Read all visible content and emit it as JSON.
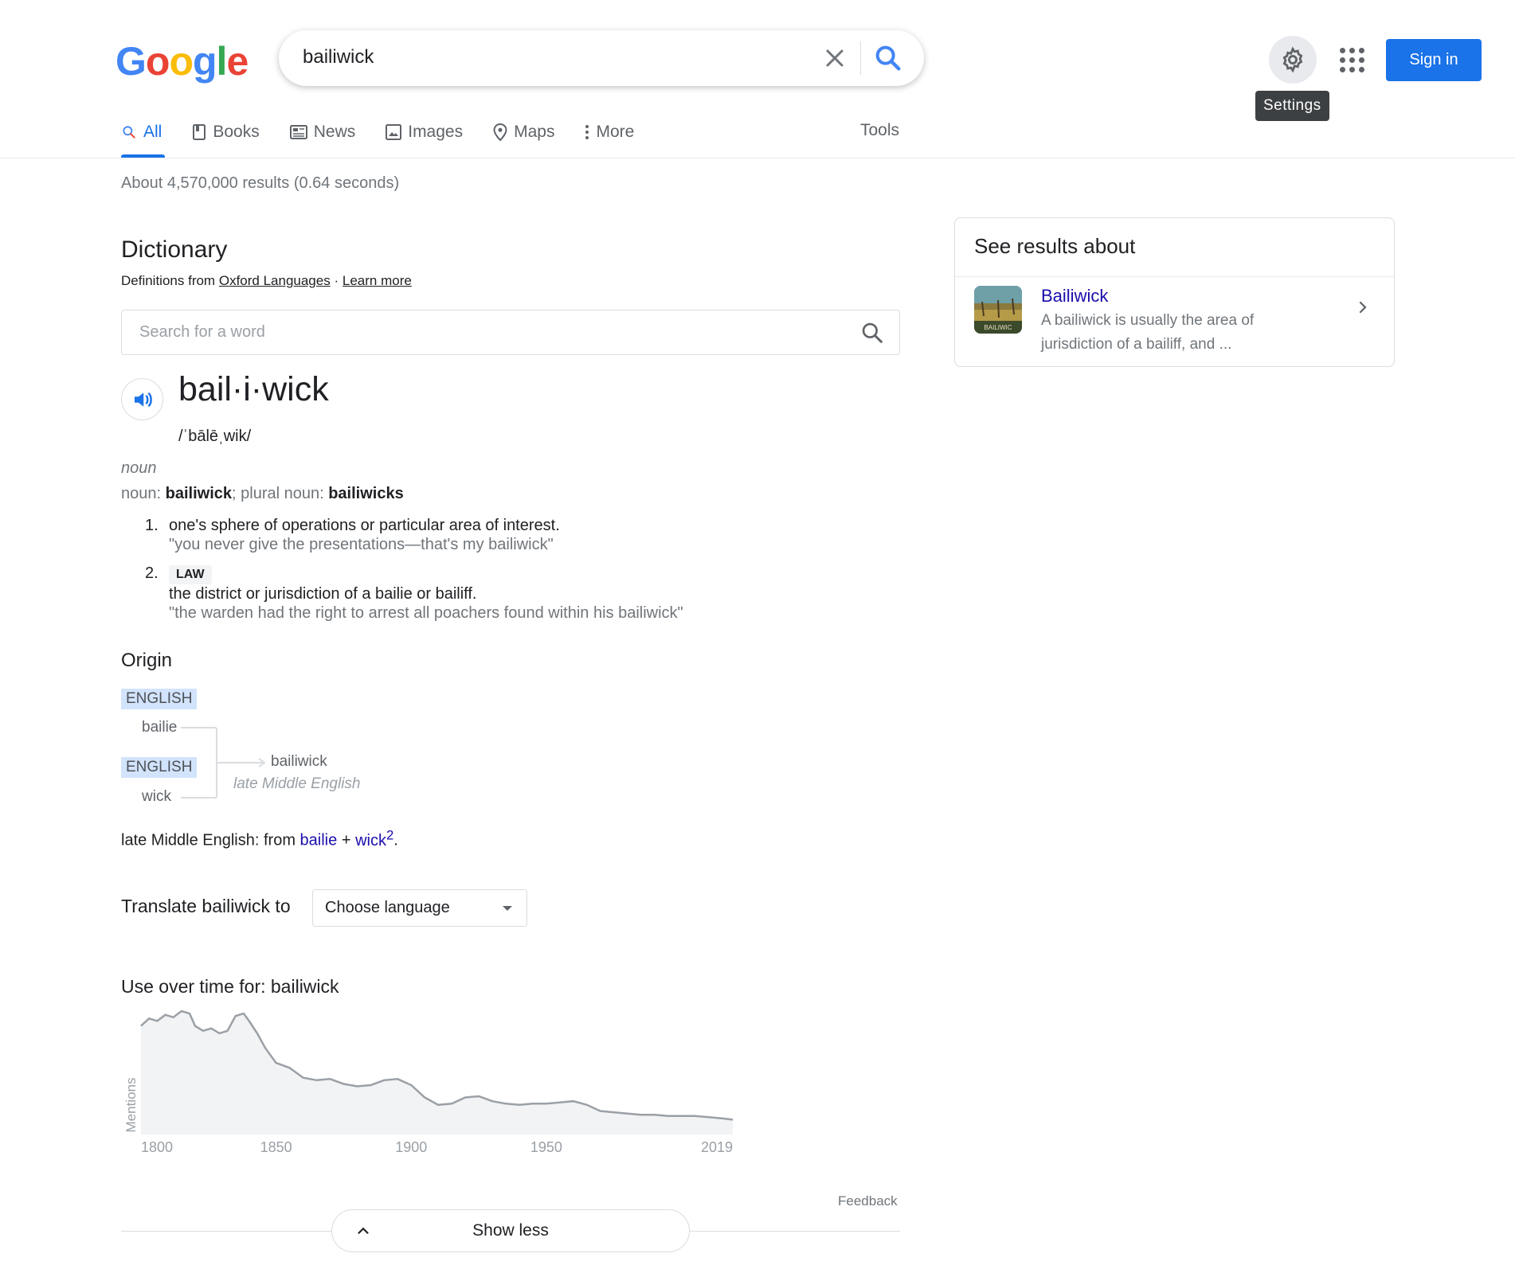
{
  "header": {
    "logo_letters": [
      {
        "ch": "G",
        "color": "#4285F4"
      },
      {
        "ch": "o",
        "color": "#EA4335"
      },
      {
        "ch": "o",
        "color": "#FBBC05"
      },
      {
        "ch": "g",
        "color": "#4285F4"
      },
      {
        "ch": "l",
        "color": "#34A853"
      },
      {
        "ch": "e",
        "color": "#EA4335"
      }
    ],
    "search_query": "bailiwick",
    "settings_tooltip": "Settings",
    "signin_label": "Sign in"
  },
  "tabs": [
    {
      "label": "All",
      "icon": "search-icon",
      "active": true
    },
    {
      "label": "Books",
      "icon": "book-icon"
    },
    {
      "label": "News",
      "icon": "news-icon"
    },
    {
      "label": "Images",
      "icon": "image-icon"
    },
    {
      "label": "Maps",
      "icon": "map-pin-icon"
    },
    {
      "label": "More",
      "icon": "more-vert-icon"
    }
  ],
  "tools_label": "Tools",
  "result_stats": "About 4,570,000 results (0.64 seconds)",
  "dictionary": {
    "title": "Dictionary",
    "source_prefix": "Definitions from",
    "source_link": "Oxford Languages",
    "source_sep": "·",
    "learn_more": "Learn more",
    "search_placeholder": "Search for a word",
    "headword": "bail·i·wick",
    "phonetic": "/ˈbālēˌwik/",
    "part_of_speech": "noun",
    "forms_noun_label": "noun:",
    "forms_noun": "bailiwick",
    "forms_sep": ";",
    "forms_plural_label": "plural noun:",
    "forms_plural": "bailiwicks",
    "definitions": [
      {
        "num": "1.",
        "text": "one's sphere of operations or particular area of interest.",
        "example": "\"you never give the presentations—that's my bailiwick\""
      },
      {
        "num": "2.",
        "tag": "LAW",
        "text": "the district or jurisdiction of a bailie or bailiff.",
        "example": "\"the warden had the right to arrest all poachers found within his bailiwick\""
      }
    ],
    "origin": {
      "title": "Origin",
      "lang1": "ENGLISH",
      "word1": "bailie",
      "lang2": "ENGLISH",
      "word2": "wick",
      "result_word": "bailiwick",
      "result_note": "late Middle English",
      "text_prefix": "late Middle English: from",
      "link1": "bailie",
      "plus": "+",
      "link2": "wick",
      "sup": "2",
      "period": "."
    },
    "translate_label": "Translate bailiwick to",
    "translate_select": "Choose language",
    "use_over_time_title": "Use over time for: bailiwick",
    "feedback": "Feedback",
    "show_less": "Show less"
  },
  "chart_data": {
    "type": "area",
    "ylabel": "Mentions",
    "xlabel": "",
    "x_ticks": [
      "1800",
      "1850",
      "1900",
      "1950",
      "2019"
    ],
    "x": [
      1800,
      1803,
      1806,
      1809,
      1812,
      1815,
      1818,
      1820,
      1823,
      1826,
      1829,
      1832,
      1835,
      1838,
      1840,
      1843,
      1846,
      1850,
      1855,
      1860,
      1865,
      1870,
      1875,
      1880,
      1885,
      1890,
      1895,
      1900,
      1905,
      1910,
      1915,
      1920,
      1925,
      1930,
      1935,
      1940,
      1945,
      1950,
      1955,
      1960,
      1965,
      1970,
      1975,
      1980,
      1985,
      1990,
      1995,
      2000,
      2005,
      2010,
      2015,
      2019
    ],
    "values": [
      88,
      94,
      92,
      97,
      95,
      100,
      98,
      88,
      84,
      86,
      82,
      84,
      96,
      98,
      92,
      82,
      70,
      58,
      54,
      46,
      44,
      45,
      41,
      39,
      40,
      44,
      45,
      40,
      30,
      24,
      25,
      30,
      31,
      27,
      25,
      24,
      25,
      25,
      26,
      27,
      24,
      19,
      18,
      17,
      16,
      16,
      15,
      15,
      15,
      14,
      13,
      12
    ],
    "xlim": [
      1800,
      2019
    ],
    "ylim": [
      0,
      100
    ],
    "grid": false,
    "colors": {
      "line": "#9aa0a6",
      "fill": "#f1f3f4"
    }
  },
  "knowledge_panel": {
    "title": "See results about",
    "item_title": "Bailiwick",
    "item_desc": "A bailiwick is usually the area of jurisdiction of a bailiff, and ...",
    "thumb_text": "BAILIWIC"
  },
  "colors": {
    "accent": "#1a73e8",
    "link": "#1a0dab",
    "origin_tag_bg": "#d2e3fc"
  }
}
